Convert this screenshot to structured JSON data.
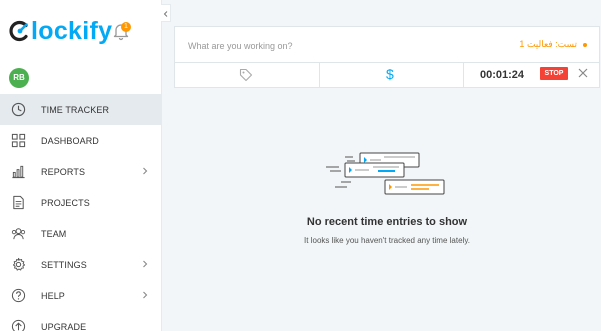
{
  "app": {
    "logo_text": "lockify",
    "notification_count": "1",
    "user_initials": "RB"
  },
  "sidebar": {
    "items": [
      {
        "label": "TIME TRACKER",
        "icon": "clock-icon",
        "active": true,
        "has_submenu": false
      },
      {
        "label": "DASHBOARD",
        "icon": "dashboard-icon",
        "active": false,
        "has_submenu": false
      },
      {
        "label": "REPORTS",
        "icon": "bar-chart-icon",
        "active": false,
        "has_submenu": true
      },
      {
        "label": "PROJECTS",
        "icon": "document-icon",
        "active": false,
        "has_submenu": false
      },
      {
        "label": "TEAM",
        "icon": "team-icon",
        "active": false,
        "has_submenu": false
      },
      {
        "label": "SETTINGS",
        "icon": "gear-icon",
        "active": false,
        "has_submenu": true
      },
      {
        "label": "HELP",
        "icon": "help-icon",
        "active": false,
        "has_submenu": true
      },
      {
        "label": "UPGRADE",
        "icon": "upgrade-icon",
        "active": false,
        "has_submenu": false
      }
    ]
  },
  "timer": {
    "description_placeholder": "What are you working on?",
    "project_label": "تست: فعالیت 1",
    "duration": "00:01:24",
    "stop_label": "STOP"
  },
  "empty_state": {
    "title": "No recent time entries to show",
    "subtitle": "It looks like you haven't tracked any time lately."
  },
  "colors": {
    "brand": "#03a9f4",
    "project": "#ff9800",
    "stop": "#f44336",
    "avatar": "#4caf50",
    "active_nav": "#e4eaee"
  }
}
